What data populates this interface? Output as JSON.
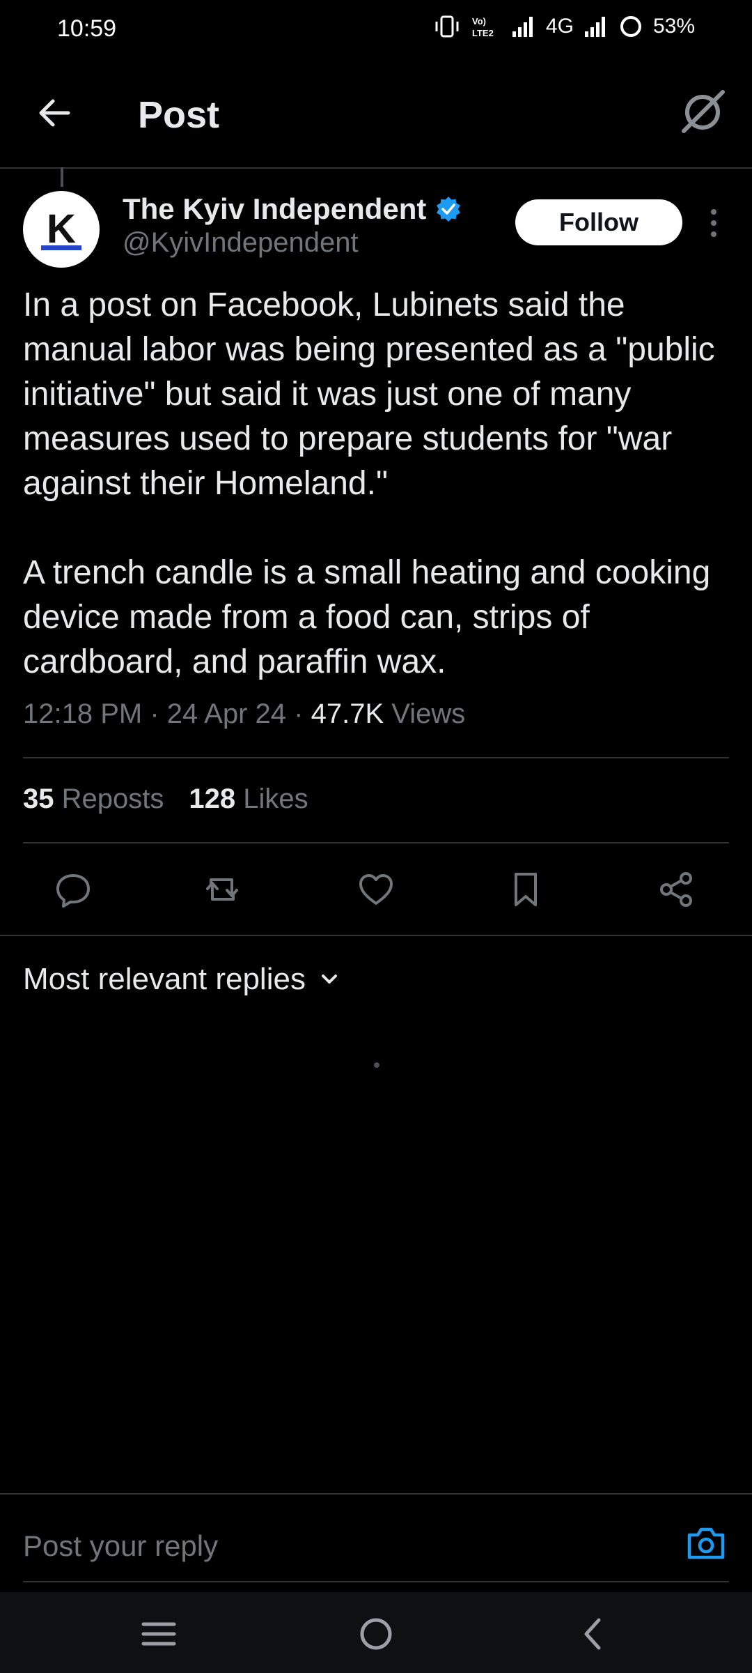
{
  "status_bar": {
    "time": "10:59",
    "network": "4G",
    "battery": "53%"
  },
  "header": {
    "title": "Post"
  },
  "post": {
    "author_name": "The Kyiv Independent",
    "author_handle": "@KyivIndependent",
    "avatar_letter": "K",
    "follow_label": "Follow",
    "text": "In a post on Facebook, Lubinets said the manual labor was being presented as a \"public initiative\" but said it was just one of many measures used to prepare students for \"war against their Homeland.\"\n\nA trench candle is a small heating and cooking device made from a food can, strips of cardboard, and paraffin wax.",
    "time": "12:18 PM",
    "date": "24 Apr 24",
    "views_count": "47.7K",
    "views_label": "Views",
    "reposts_count": "35",
    "reposts_label": "Reposts",
    "likes_count": "128",
    "likes_label": "Likes"
  },
  "replies": {
    "sort_label": "Most relevant replies"
  },
  "reply_bar": {
    "placeholder": "Post your reply"
  },
  "colors": {
    "background": "#000000",
    "text": "#e7e9ea",
    "muted": "#71767b",
    "accent": "#1d9bf0",
    "divider": "#2f3336"
  },
  "icons": {
    "back": "arrow-left-icon",
    "grok": "grok-icon",
    "verified": "verified-badge-icon",
    "more": "more-vertical-icon",
    "reply": "reply-icon",
    "repost": "repost-icon",
    "like": "heart-icon",
    "bookmark": "bookmark-icon",
    "share": "share-icon",
    "camera": "camera-icon"
  }
}
